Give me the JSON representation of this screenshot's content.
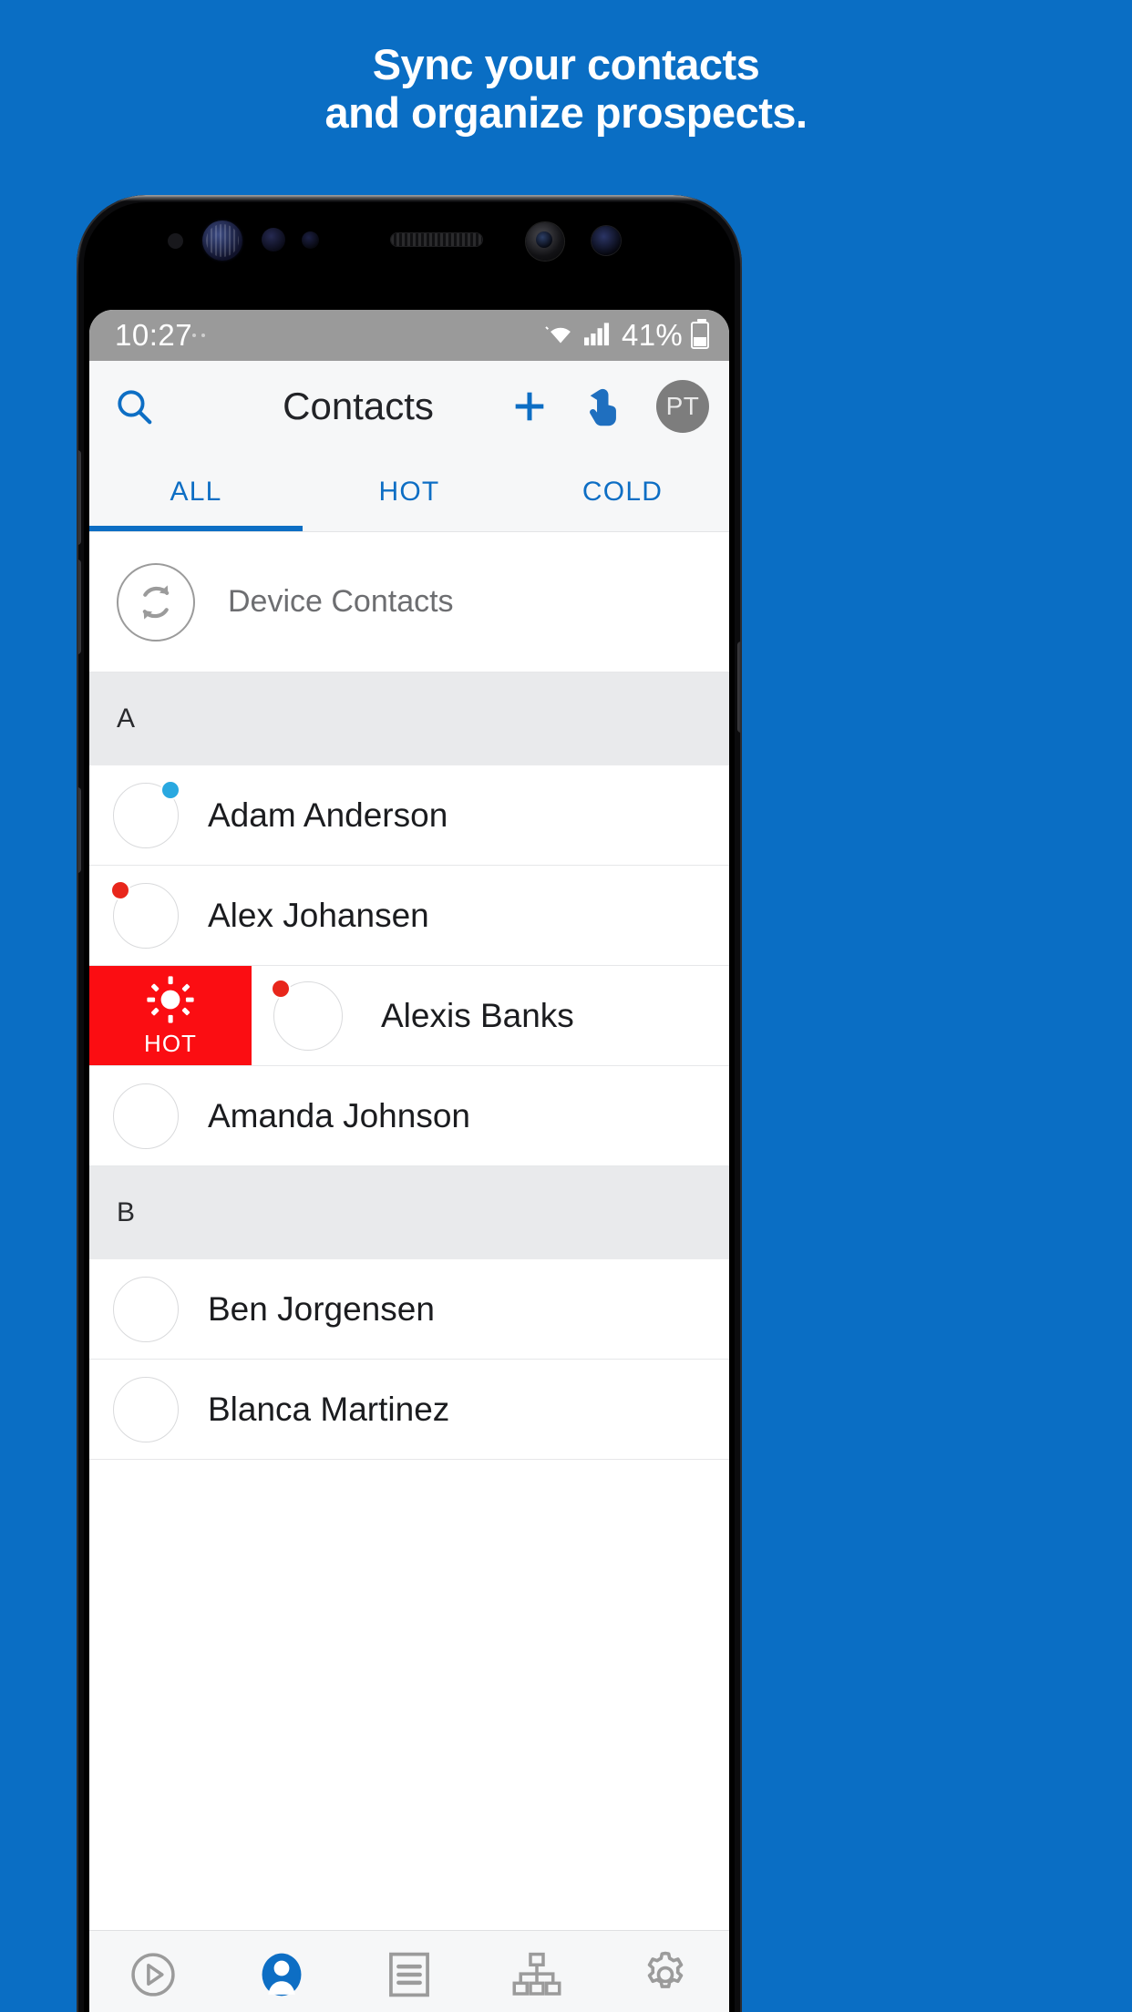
{
  "headline": {
    "line1": "Sync your contacts",
    "line2": "and organize prospects."
  },
  "colors": {
    "background": "#0a6ec4",
    "accent": "#0d6ec4",
    "hot": "#fb0d12",
    "status_bar": "#9a9a9a",
    "toolbar": "#f6f7f8",
    "section_header": "#e9eaec"
  },
  "status_bar": {
    "time": "10:27",
    "battery_percent": "41%",
    "wifi_icon": "wifi-icon",
    "signal_icon": "signal-bars-icon",
    "battery_icon": "battery-charging-icon"
  },
  "toolbar": {
    "title": "Contacts",
    "search_icon": "search-icon",
    "add_icon": "plus-icon",
    "touch_icon": "tap-gesture-icon",
    "avatar_initials": "PT"
  },
  "tabs": {
    "items": [
      {
        "label": "ALL",
        "active": true
      },
      {
        "label": "HOT",
        "active": false
      },
      {
        "label": "COLD",
        "active": false
      }
    ]
  },
  "device_contacts": {
    "label": "Device Contacts",
    "icon": "sync-icon"
  },
  "list": [
    {
      "type": "section",
      "label": "A"
    },
    {
      "type": "contact",
      "name": "Adam Anderson",
      "dot": "blue",
      "avatar": "adam"
    },
    {
      "type": "contact",
      "name": "Alex Johansen",
      "dot": "red",
      "avatar": "alex"
    },
    {
      "type": "contact",
      "name": "Alexis Banks",
      "dot": "red",
      "avatar": "alexis",
      "swiped": true,
      "swipe_action": {
        "label": "HOT",
        "icon": "sun-icon",
        "color": "#fb0d12"
      }
    },
    {
      "type": "contact",
      "name": "Amanda Johnson",
      "dot": "none",
      "avatar": "amanda"
    },
    {
      "type": "section",
      "label": "B"
    },
    {
      "type": "contact",
      "name": "Ben Jorgensen",
      "dot": "none",
      "avatar": "ben"
    },
    {
      "type": "contact",
      "name": "Blanca Martinez",
      "dot": "none",
      "avatar": "blanca"
    }
  ],
  "bottom_nav": [
    {
      "icon": "play-circle-icon",
      "active": false
    },
    {
      "icon": "person-icon",
      "active": true
    },
    {
      "icon": "list-document-icon",
      "active": false
    },
    {
      "icon": "org-chart-icon",
      "active": false
    },
    {
      "icon": "gear-icon",
      "active": false
    }
  ]
}
